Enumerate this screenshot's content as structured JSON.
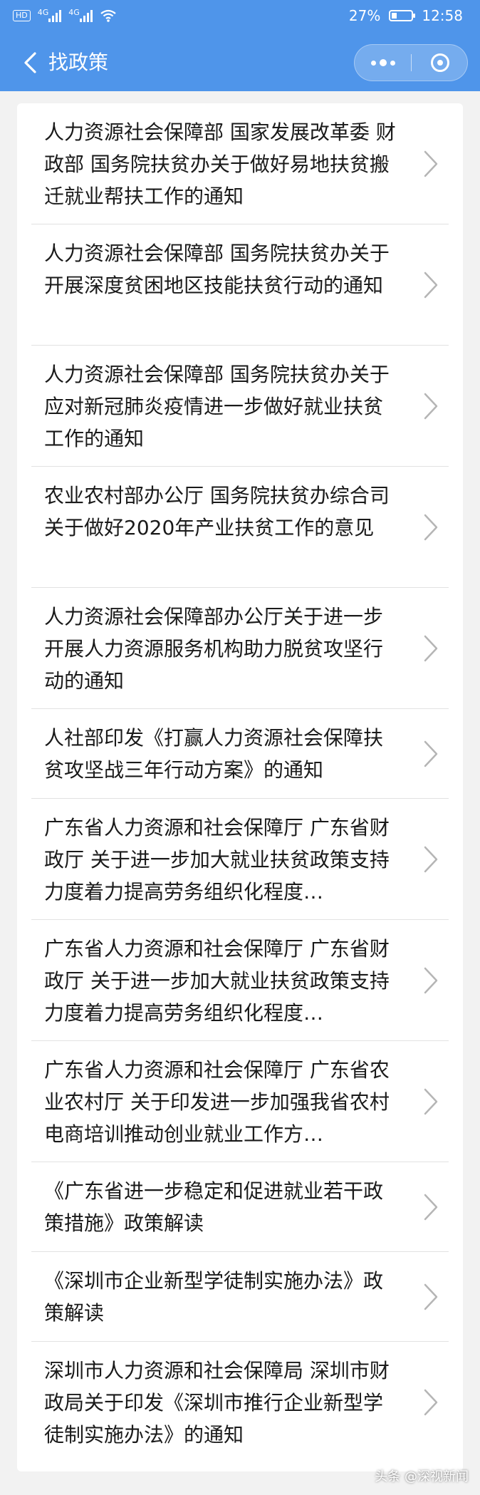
{
  "status_bar": {
    "network": "HD",
    "sim1": "4G",
    "sim2": "4G",
    "battery": "27%",
    "time": "12:58"
  },
  "nav": {
    "title": "找政策",
    "back_icon": "chevron-left-icon",
    "more_icon": "more-dots-icon",
    "close_icon": "target-icon"
  },
  "policies": [
    {
      "title": "人力资源社会保障部 国家发展改革委 财政部 国务院扶贫办关于做好易地扶贫搬迁就业帮扶工作的通知"
    },
    {
      "title": "人力资源社会保障部 国务院扶贫办关于开展深度贫困地区技能扶贫行动的通知"
    },
    {
      "title": "人力资源社会保障部 国务院扶贫办关于应对新冠肺炎疫情进一步做好就业扶贫工作的通知"
    },
    {
      "title": "农业农村部办公厅 国务院扶贫办综合司关于做好2020年产业扶贫工作的意见"
    },
    {
      "title": "人力资源社会保障部办公厅关于进一步开展人力资源服务机构助力脱贫攻坚行动的通知"
    },
    {
      "title": "人社部印发《打赢人力资源社会保障扶贫攻坚战三年行动方案》的通知"
    },
    {
      "title": "广东省人力资源和社会保障厅 广东省财政厅 关于进一步加大就业扶贫政策支持力度着力提高劳务组织化程度…"
    },
    {
      "title": "广东省人力资源和社会保障厅 广东省财政厅 关于进一步加大就业扶贫政策支持力度着力提高劳务组织化程度…"
    },
    {
      "title": "广东省人力资源和社会保障厅 广东省农业农村厅 关于印发进一步加强我省农村电商培训推动创业就业工作方…"
    },
    {
      "title": "《广东省进一步稳定和促进就业若干政策措施》政策解读"
    },
    {
      "title": "《深圳市企业新型学徒制实施办法》政策解读"
    },
    {
      "title": "深圳市人力资源和社会保障局 深圳市财政局关于印发《深圳市推行企业新型学徒制实施办法》的通知"
    }
  ],
  "watermark": "头条 @深视新闻",
  "colors": {
    "accent": "#4f95ea",
    "background": "#f2f2f2",
    "divider": "#e2e2e2"
  }
}
